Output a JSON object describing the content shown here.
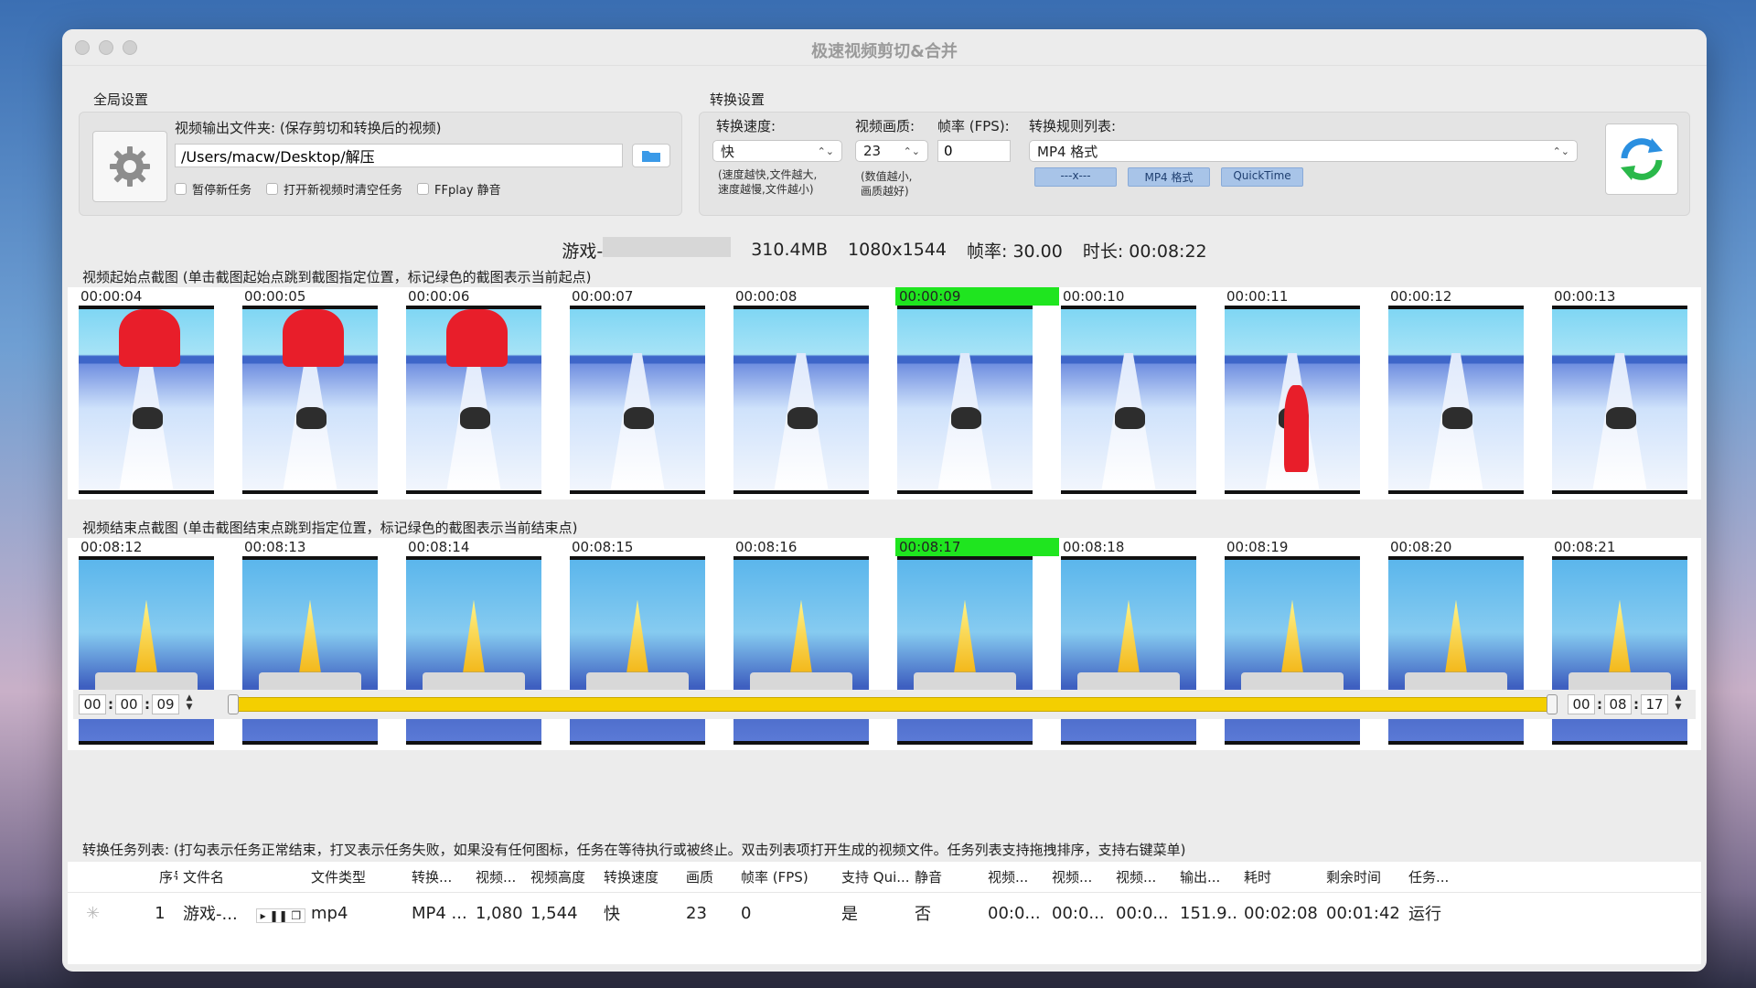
{
  "window": {
    "title": "极速视频剪切&合并"
  },
  "global": {
    "label": "全局设置",
    "output_label": "视频输出文件夹: (保存剪切和转换后的视频)",
    "output_path": "/Users/macw/Desktop/解压",
    "checks": [
      "暂停新任务",
      "打开新视频时清空任务",
      "FFplay 静音"
    ]
  },
  "convert": {
    "label": "转换设置",
    "speed_label": "转换速度:",
    "speed_value": "快",
    "speed_note1": "(速度越快,文件越大,",
    "speed_note2": "速度越慢,文件越小)",
    "quality_label": "视频画质:",
    "quality_value": "23",
    "quality_note1": "(数值越小,",
    "quality_note2": "画质越好)",
    "fps_label": "帧率 (FPS):",
    "fps_value": "0",
    "rules_label": "转换规则列表:",
    "rules_value": "MP4 格式",
    "tags": [
      "---x---",
      "MP4 格式",
      "QuickTime"
    ]
  },
  "info": {
    "name": "游戏-",
    "size": "310.4MB",
    "resolution": "1080x1544",
    "fps": "帧率: 30.00",
    "duration": "时长: 00:08:22"
  },
  "start_strip": {
    "label": "视频起始点截图 (单击截图起始点跳到截图指定位置，标记绿色的截图表示当前起点)",
    "times": [
      "00:00:04",
      "00:00:05",
      "00:00:06",
      "00:00:07",
      "00:00:08",
      "00:00:09",
      "00:00:10",
      "00:00:11",
      "00:00:12",
      "00:00:13"
    ],
    "selected_index": 5
  },
  "end_strip": {
    "label": "视频结束点截图 (单击截图结束点跳到指定位置，标记绿色的截图表示当前结束点)",
    "times": [
      "00:08:12",
      "00:08:13",
      "00:08:14",
      "00:08:15",
      "00:08:16",
      "00:08:17",
      "00:08:18",
      "00:08:19",
      "00:08:20",
      "00:08:21"
    ],
    "selected_index": 5
  },
  "timeline": {
    "start": [
      "00",
      "00",
      "09"
    ],
    "end": [
      "00",
      "08",
      "17"
    ]
  },
  "tasks": {
    "label": "转换任务列表: (打勾表示任务正常结束，打叉表示任务失败，如果没有任何图标，任务在等待执行或被终止。双击列表项打开生成的视频文件。任务列表支持拖拽排序，支持右键菜单)",
    "headers": [
      "序号",
      "文件名",
      "文件类型",
      "转换...",
      "视频...",
      "视频高度",
      "转换速度",
      "画质",
      "帧率 (FPS)",
      "支持 Qui...",
      "静音",
      "视频...",
      "视频...",
      "视频...",
      "输出...",
      "耗时",
      "剩余时间",
      "任务..."
    ],
    "row": [
      "1",
      "游戏-...",
      "mp4",
      "MP4 ...",
      "1,080",
      "1,544",
      "快",
      "23",
      "0",
      "是",
      "否",
      "00:0...",
      "00:0...",
      "00:0...",
      "151.9...",
      "00:02:08",
      "00:01:42",
      "运行"
    ]
  },
  "colors": {
    "selected_green": "#1fe51f",
    "slider_yellow": "#f4cf00"
  }
}
